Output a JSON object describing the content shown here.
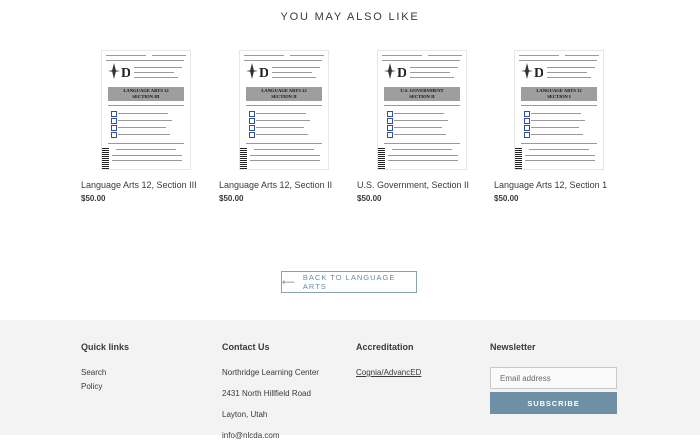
{
  "section_title": "YOU MAY ALSO LIKE",
  "products": [
    {
      "title": "Language Arts 12, Section III",
      "price": "$50.00",
      "doc_heading_1": "LANGUAGE ARTS 12",
      "doc_heading_2": "SECTION III"
    },
    {
      "title": "Language Arts 12, Section II",
      "price": "$50.00",
      "doc_heading_1": "LANGUAGE ARTS 12",
      "doc_heading_2": "SECTION II"
    },
    {
      "title": "U.S. Government, Section II",
      "price": "$50.00",
      "doc_heading_1": "U.S. GOVERNMENT",
      "doc_heading_2": "SECTION II"
    },
    {
      "title": "Language Arts 12, Section 1",
      "price": "$50.00",
      "doc_heading_1": "LANGUAGE ARTS 12",
      "doc_heading_2": "SECTION I"
    }
  ],
  "back_button": {
    "arrow": "⟵",
    "label": "BACK TO LANGUAGE ARTS"
  },
  "footer": {
    "quick_links": {
      "heading": "Quick links",
      "items": [
        "Search",
        "Policy"
      ]
    },
    "contact": {
      "heading": "Contact Us",
      "lines": [
        "Northridge Learning Center",
        "2431 North Hillfield Road",
        "Layton, Utah",
        "info@nlcda.com"
      ]
    },
    "accreditation": {
      "heading": "Accreditation",
      "link": "Cognia/AdvancED"
    },
    "newsletter": {
      "heading": "Newsletter",
      "placeholder": "Email address",
      "button": "SUBSCRIBE"
    }
  },
  "colors": {
    "accent": "#6f8fa4",
    "footer_bg": "#f3f3f3",
    "text": "#3a3a3a"
  }
}
